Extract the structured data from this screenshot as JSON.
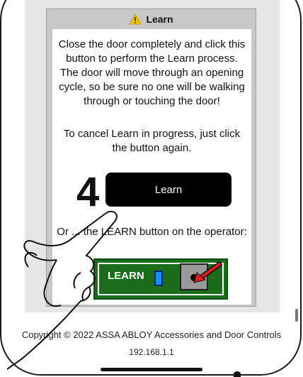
{
  "dialog": {
    "title": "Learn",
    "title_icon": "warning-icon",
    "paragraph_1": "Close the door completely and click this button to perform the Learn process. The door will move through an opening cycle, so be sure no one will be walking through or touching the door!",
    "paragraph_2": "To cancel Learn in progress, just click the button again.",
    "step_number": "4",
    "learn_button_label": "Learn",
    "paragraph_3": "Or ... the LEARN button on the operator:",
    "board_label": "LEARN"
  },
  "footer": {
    "copyright": "Copyright © 2022 ASSA ABLOY Accessories and Door Controls",
    "ip_address": "192.168.1.1"
  },
  "colors": {
    "dialog_frame": "#c8c8c8",
    "button": "#000000",
    "board": "#1a6e1a",
    "arrow": "#e02020",
    "warning": "#f5c400"
  }
}
